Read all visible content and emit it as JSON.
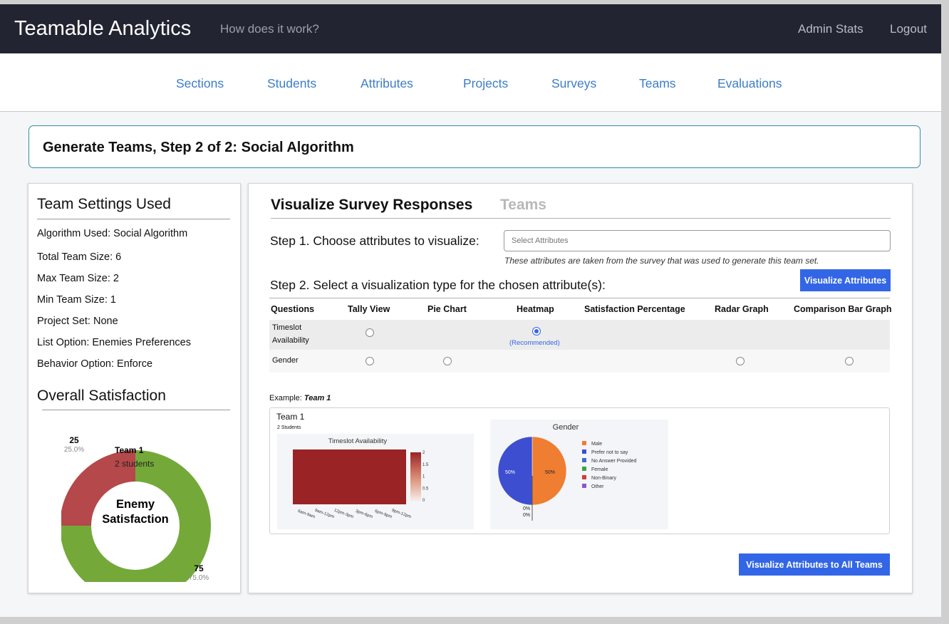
{
  "header": {
    "brand": "Teamable Analytics",
    "how_link": "How does it work?",
    "admin_link": "Admin Stats",
    "logout_link": "Logout"
  },
  "nav": {
    "items": [
      "Sections",
      "Students",
      "Attributes",
      "Projects",
      "Surveys",
      "Teams",
      "Evaluations"
    ]
  },
  "step_title": "Generate Teams, Step 2 of 2: Social Algorithm",
  "settings": {
    "title": "Team Settings Used",
    "lines": [
      "Algorithm Used: Social Algorithm",
      "Total Team Size: 6",
      "Max Team Size: 2",
      "Min Team Size: 1",
      "Project Set: None",
      "List Option: Enemies Preferences",
      "Behavior Option: Enforce"
    ]
  },
  "satisfaction": {
    "title": "Overall Satisfaction",
    "center_line1": "Enemy",
    "center_line2": "Satisfaction",
    "hover_title": "Team 1",
    "hover_sub": "2 students",
    "slices": [
      {
        "value": 25,
        "percent": "25.0%",
        "label": "25",
        "color": "#b5484a"
      },
      {
        "value": 75,
        "percent": "75.0%",
        "label": "75",
        "color": "#74a93a"
      }
    ]
  },
  "visualize": {
    "tab_active": "Visualize Survey Responses",
    "tab_inactive": "Teams",
    "step1_label": "Step 1. Choose attributes to visualize:",
    "attr_placeholder": "Select Attributes",
    "help_text": "These attributes are taken from the survey that was used to generate this team set.",
    "step2_label": "Step 2. Select a visualization type for the chosen attribute(s):",
    "visualize_button": "Visualize Attributes",
    "all_teams_button": "Visualize Attributes to All Teams",
    "columns": [
      "Questions",
      "Tally View",
      "Pie Chart",
      "Heatmap",
      "Satisfaction Percentage",
      "Radar Graph",
      "Comparison Bar Graph"
    ],
    "rows": [
      {
        "question": [
          "Timeslot",
          "Availability"
        ],
        "recommended": "(Recommended)"
      },
      {
        "question": [
          "Gender"
        ]
      }
    ],
    "example_label": "Example: ",
    "example_team": "Team 1"
  },
  "example_panel": {
    "team": "Team 1",
    "students": "2 Students",
    "heatmap_title": "Timeslot Availability",
    "heatmap_xticks": [
      "6am-9am",
      "9am-12pm",
      "12pm-3pm",
      "3pm-6pm",
      "6pm-9pm",
      "9pm-12pm"
    ],
    "heatmap_scale": [
      "2",
      "1.5",
      "1",
      "0.5",
      "0"
    ],
    "pie_title": "Gender",
    "pie_labels": [
      "50%",
      "50%",
      "0%",
      "0%"
    ],
    "pie_legend": [
      "Male",
      "Prefer not to say",
      "No Answer Provided",
      "Female",
      "Non-Binary",
      "Other"
    ],
    "pie_colors": [
      "#ef7d32",
      "#3d4fd0",
      "#3d6fc8",
      "#3aa447",
      "#d23b3b",
      "#8a57c8"
    ]
  },
  "chart_data": {
    "type": "pie",
    "categories": [
      "Male",
      "Prefer not to say",
      "No Answer Provided",
      "Female",
      "Non-Binary",
      "Other"
    ],
    "values": [
      50,
      50,
      0,
      0,
      0,
      0
    ],
    "title": "Gender"
  }
}
